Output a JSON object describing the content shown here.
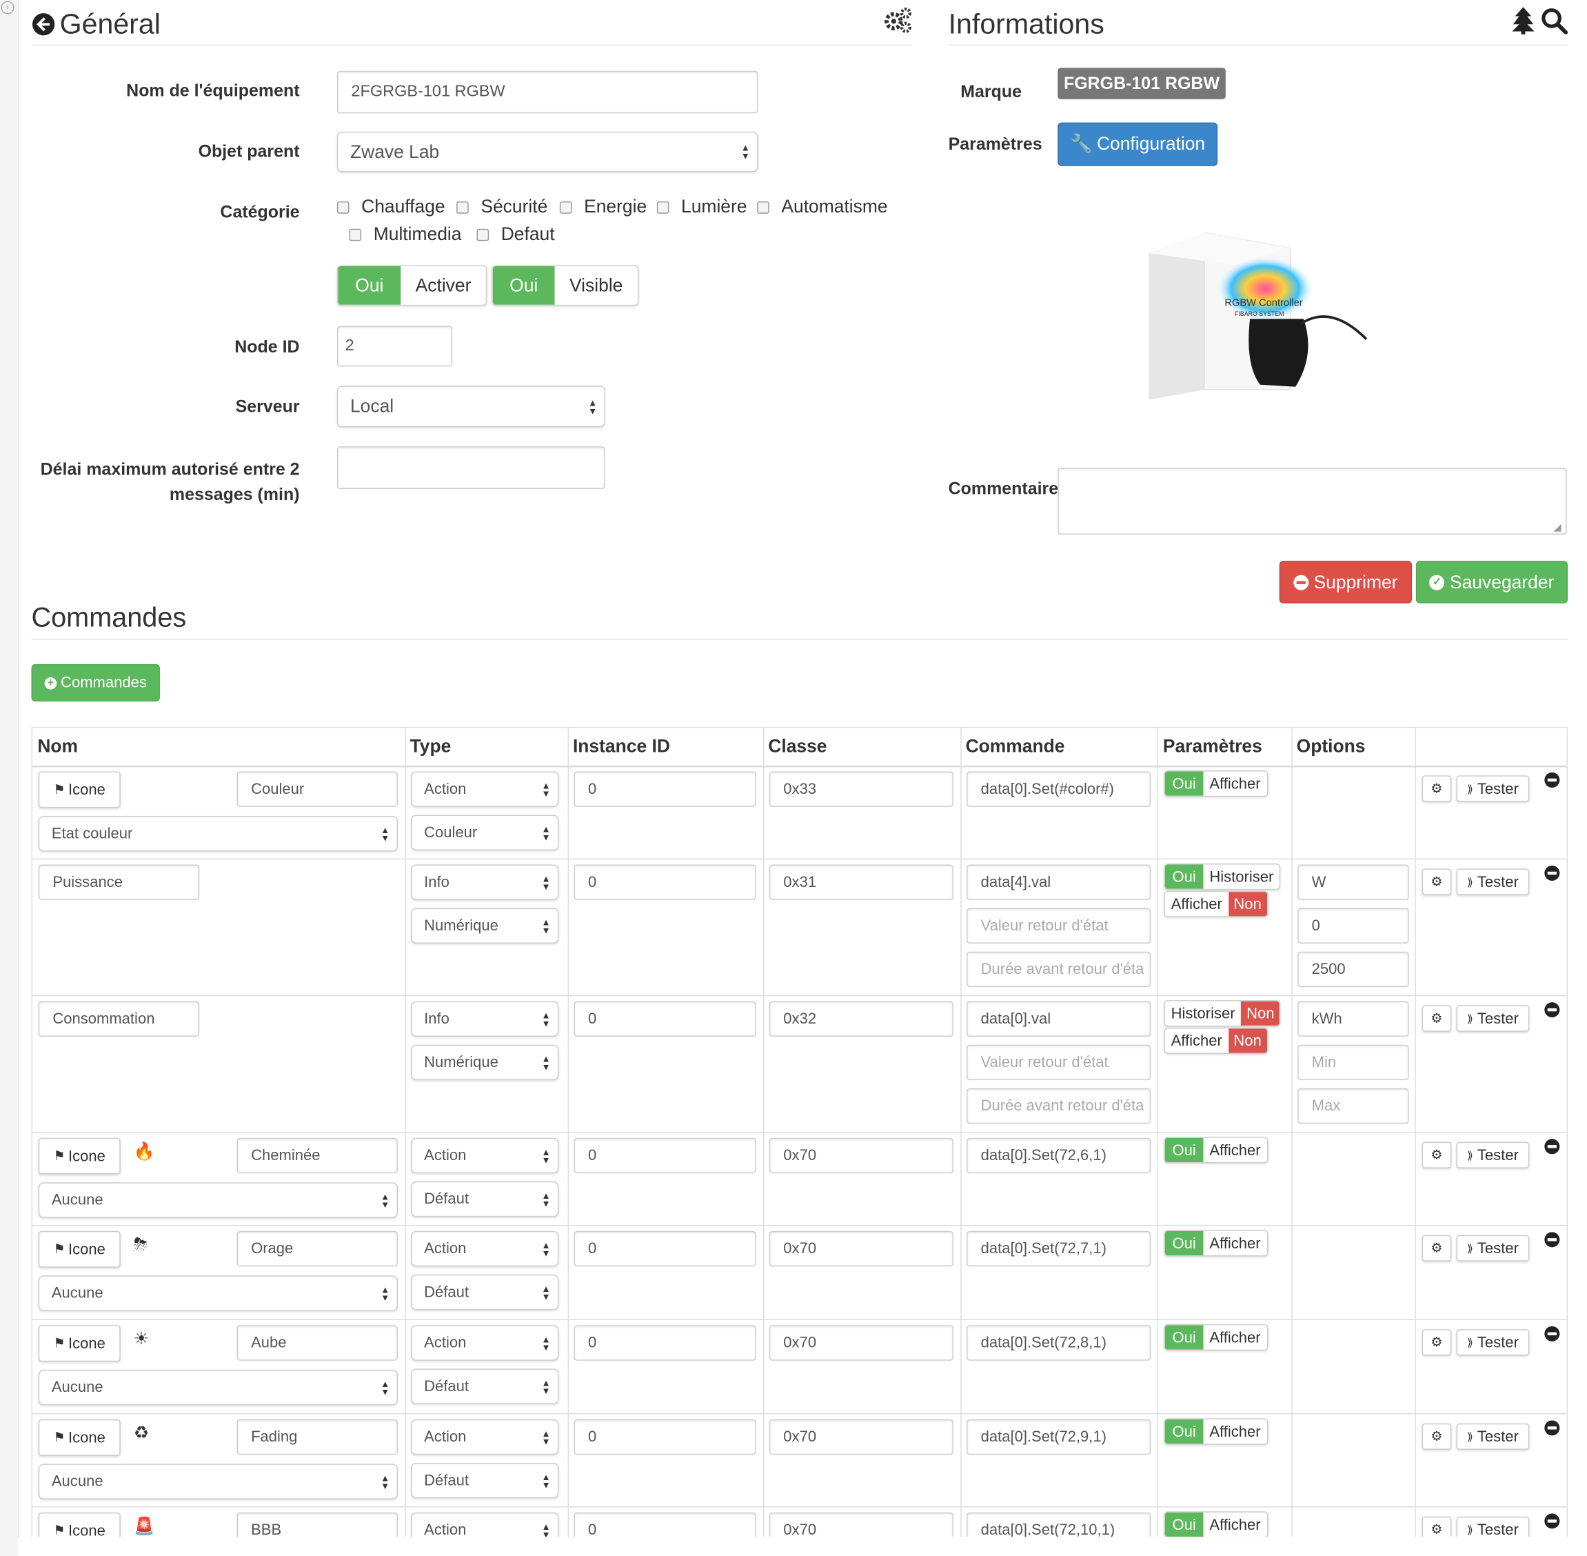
{
  "general": {
    "title": "Général",
    "fields": {
      "name_label": "Nom de l'équipement",
      "name_value": "2FGRGB-101 RGBW",
      "parent_label": "Objet parent",
      "parent_value": "Zwave Lab",
      "category_label": "Catégorie",
      "categories": [
        "Chauffage",
        "Sécurité",
        "Energie",
        "Lumière",
        "Automatisme",
        "Multimedia",
        "Defaut"
      ],
      "activate_on": "Oui",
      "activate_label": "Activer",
      "visible_on": "Oui",
      "visible_label": "Visible",
      "node_label": "Node ID",
      "node_value": "2",
      "server_label": "Serveur",
      "server_value": "Local",
      "delay_label_1": "Délai maximum autorisé entre 2",
      "delay_label_2": "messages (min)",
      "delay_value": ""
    }
  },
  "info": {
    "title": "Informations",
    "brand_label": "Marque",
    "brand_value": "FGRGB-101 RGBW",
    "params_label": "Paramètres",
    "config_button": "Configuration",
    "comment_label": "Commentaire",
    "delete_button": "Supprimer",
    "save_button": "Sauvegarder",
    "product_box_text": "RGBW Controller",
    "product_box_text_2": "FIBARO SYSTEM"
  },
  "commands": {
    "title": "Commandes",
    "add_button": "Commandes",
    "columns": [
      "Nom",
      "Type",
      "Instance ID",
      "Classe",
      "Commande",
      "Paramètres",
      "Options"
    ],
    "icon_button": "Icone",
    "tester_button": "Tester",
    "rows": [
      {
        "name": "Couleur",
        "icon": "",
        "sub": "Etat couleur",
        "type": "Action",
        "subtype": "Couleur",
        "instance": "0",
        "classe": "0x33",
        "cmd": "data[0].Set(#color#)",
        "params": [
          {
            "on": "Oui",
            "label": "Afficher"
          }
        ],
        "options": []
      },
      {
        "name": "Puissance",
        "type": "Info",
        "subtype": "Numérique",
        "instance": "0",
        "classe": "0x31",
        "cmd": "data[4].val",
        "cmd_ph1": "Valeur retour d'état",
        "cmd_ph2": "Durée avant retour d'éta",
        "params": [
          {
            "on": "Oui",
            "label": "Historiser"
          },
          {
            "label": "Afficher",
            "off": "Non"
          }
        ],
        "options": [
          "W",
          "0",
          "2500"
        ]
      },
      {
        "name": "Consommation",
        "type": "Info",
        "subtype": "Numérique",
        "instance": "0",
        "classe": "0x32",
        "cmd": "data[0].val",
        "cmd_ph1": "Valeur retour d'état",
        "cmd_ph2": "Durée avant retour d'éta",
        "params": [
          {
            "label": "Historiser",
            "off": "Non"
          },
          {
            "label": "Afficher",
            "off": "Non"
          }
        ],
        "options": [
          "kWh"
        ],
        "options_ph": [
          "Min",
          "Max"
        ]
      },
      {
        "name": "Cheminée",
        "icon": "🔥",
        "sub": "Aucune",
        "type": "Action",
        "subtype": "Défaut",
        "instance": "0",
        "classe": "0x70",
        "cmd": "data[0].Set(72,6,1)",
        "params": [
          {
            "on": "Oui",
            "label": "Afficher"
          }
        ]
      },
      {
        "name": "Orage",
        "icon": "⛈",
        "sub": "Aucune",
        "type": "Action",
        "subtype": "Défaut",
        "instance": "0",
        "classe": "0x70",
        "cmd": "data[0].Set(72,7,1)",
        "params": [
          {
            "on": "Oui",
            "label": "Afficher"
          }
        ]
      },
      {
        "name": "Aube",
        "icon": "☀",
        "sub": "Aucune",
        "type": "Action",
        "subtype": "Défaut",
        "instance": "0",
        "classe": "0x70",
        "cmd": "data[0].Set(72,8,1)",
        "params": [
          {
            "on": "Oui",
            "label": "Afficher"
          }
        ]
      },
      {
        "name": "Fading",
        "icon": "♻",
        "sub": "Aucune",
        "type": "Action",
        "subtype": "Défaut",
        "instance": "0",
        "classe": "0x70",
        "cmd": "data[0].Set(72,9,1)",
        "params": [
          {
            "on": "Oui",
            "label": "Afficher"
          }
        ]
      },
      {
        "name": "BBB",
        "icon": "🚨",
        "sub": "",
        "type": "Action",
        "subtype": "",
        "instance": "0",
        "classe": "0x70",
        "cmd": "data[0].Set(72,10,1)",
        "params": [
          {
            "on": "Oui",
            "label": "Afficher"
          }
        ]
      }
    ]
  },
  "colors": {
    "green": "#5cb85c",
    "red": "#d9534f",
    "blue": "#3a87cc",
    "grey": "#777777"
  }
}
